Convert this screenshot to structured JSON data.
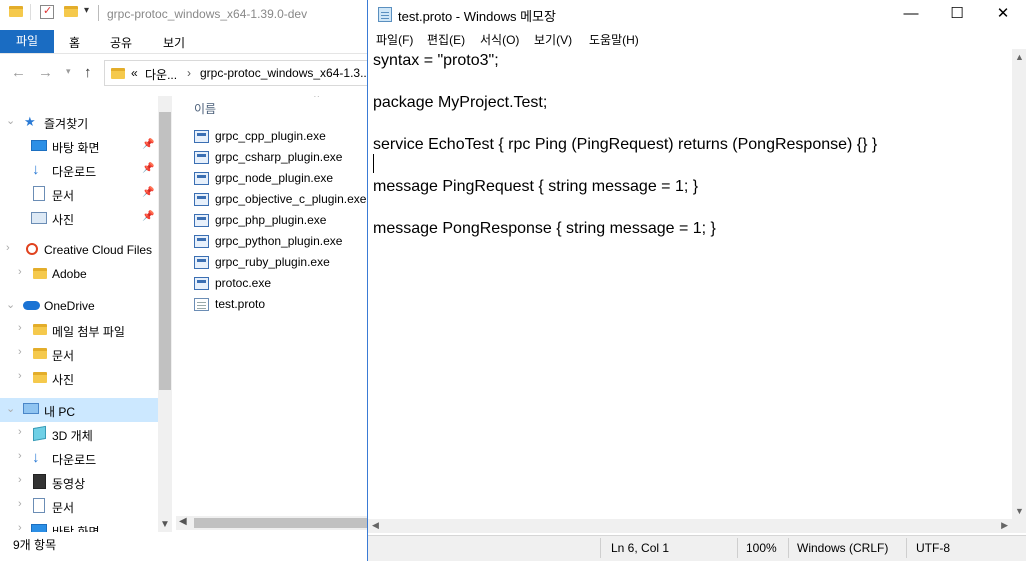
{
  "explorer": {
    "title": "grpc-protoc_windows_x64-1.39.0-dev",
    "ribbon_tabs": [
      "파일",
      "홈",
      "공유",
      "보기"
    ],
    "address": {
      "prefix": "«",
      "crumbs": [
        "다운...",
        "grpc-protoc_windows_x64-1.3..."
      ]
    },
    "nav": {
      "quick_access": "즐겨찾기",
      "quick_items": [
        "바탕 화면",
        "다운로드",
        "문서",
        "사진"
      ],
      "creative_cloud": "Creative Cloud Files",
      "creative_items": [
        "Adobe"
      ],
      "onedrive": "OneDrive",
      "onedrive_items": [
        "메일 첨부 파일",
        "문서",
        "사진"
      ],
      "this_pc": "내 PC",
      "pc_items": [
        "3D 개체",
        "다운로드",
        "동영상",
        "문서",
        "바탕 화면"
      ]
    },
    "file_list": {
      "column_name": "이름",
      "files": [
        "grpc_cpp_plugin.exe",
        "grpc_csharp_plugin.exe",
        "grpc_node_plugin.exe",
        "grpc_objective_c_plugin.exe",
        "grpc_php_plugin.exe",
        "grpc_python_plugin.exe",
        "grpc_ruby_plugin.exe",
        "protoc.exe",
        "test.proto"
      ]
    },
    "status": "9개 항목"
  },
  "notepad": {
    "title": "test.proto - Windows 메모장",
    "menu": [
      "파일(F)",
      "편집(E)",
      "서식(O)",
      "보기(V)",
      "도움말(H)"
    ],
    "lines": [
      "syntax = \"proto3\";",
      "",
      "package MyProject.Test;",
      "",
      "service EchoTest { rpc Ping (PingRequest) returns (PongResponse) {} }",
      "",
      "message PingRequest { string message = 1; }",
      "",
      "message PongResponse { string message = 1; }"
    ],
    "status": {
      "position": "Ln 6, Col 1",
      "zoom": "100%",
      "line_ending": "Windows (CRLF)",
      "encoding": "UTF-8"
    },
    "window_buttons": {
      "minimize": "—",
      "maximize": "☐",
      "close": "✕"
    }
  },
  "colors": {
    "accent": "#1a6cc2",
    "selection": "#cce8ff"
  }
}
